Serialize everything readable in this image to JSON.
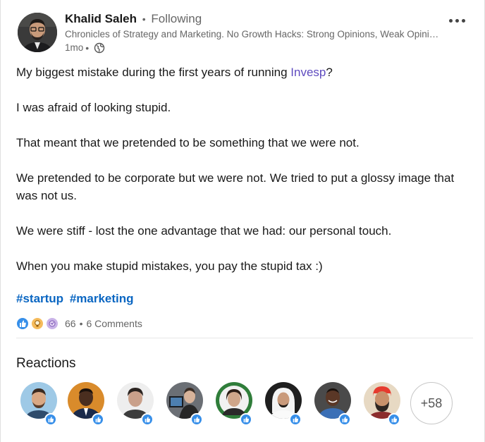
{
  "post": {
    "author_name": "Khalid Saleh",
    "separator": "•",
    "follow_status": "Following",
    "headline": "Chronicles of Strategy and Marketing. No Growth Hacks: Strong Opinions, Weak Opinions Loosely Held...",
    "age": "1mo",
    "meta_separator": "•",
    "body": {
      "line1_prefix": "My biggest mistake during the first years of running ",
      "line1_mention": "Invesp",
      "line1_suffix": "?",
      "p2": "I was afraid of looking stupid.",
      "p3": "That meant that we pretended to be something that we were not.",
      "p4": "We pretended to be corporate but we were not. We tried to put a glossy image that was not us.",
      "p5": "We were stiff - lost the one advantage that we had: our personal touch.",
      "p6": "When you make stupid mistakes, you pay the stupid tax :)"
    },
    "hashtags": [
      "#startup",
      "#marketing"
    ]
  },
  "social": {
    "reaction_count": "66",
    "separator": "•",
    "comments": "6 Comments",
    "reaction_types": [
      "like-icon",
      "insightful-icon",
      "celebrate-icon"
    ]
  },
  "reactions_panel": {
    "title": "Reactions",
    "more_count": "+58"
  },
  "colors": {
    "link_blue": "#0a66c2",
    "mention_purple": "#5e4bbf",
    "like_blue": "#378fe9",
    "text_secondary": "#666666"
  }
}
